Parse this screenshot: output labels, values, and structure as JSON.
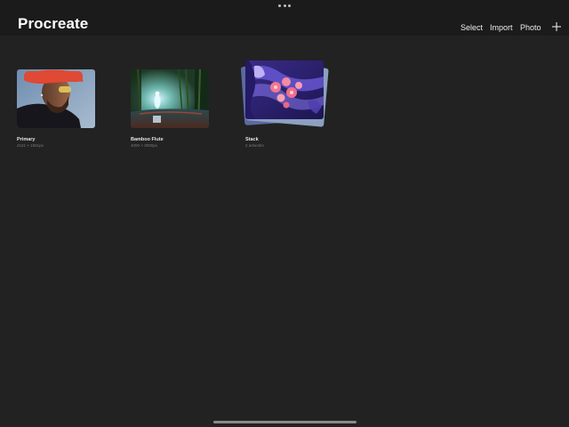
{
  "header": {
    "app_title": "Procreate",
    "select_label": "Select",
    "import_label": "Import",
    "photo_label": "Photo",
    "new_canvas_icon": "plus-icon",
    "multitasking_icon": "more-dots-icon"
  },
  "gallery": {
    "items": [
      {
        "title": "Primary",
        "dimensions": "2121 × 1591px",
        "kind": "artwork"
      },
      {
        "title": "Bamboo Flute",
        "dimensions": "4000 × 3000px",
        "kind": "artwork"
      },
      {
        "title": "Stack",
        "dimensions": "2 artworks",
        "kind": "stack"
      }
    ]
  },
  "colors": {
    "background": "#222222",
    "header_background": "#1b1b1b",
    "text_primary": "#ffffff",
    "text_secondary": "#7a7a7a"
  }
}
